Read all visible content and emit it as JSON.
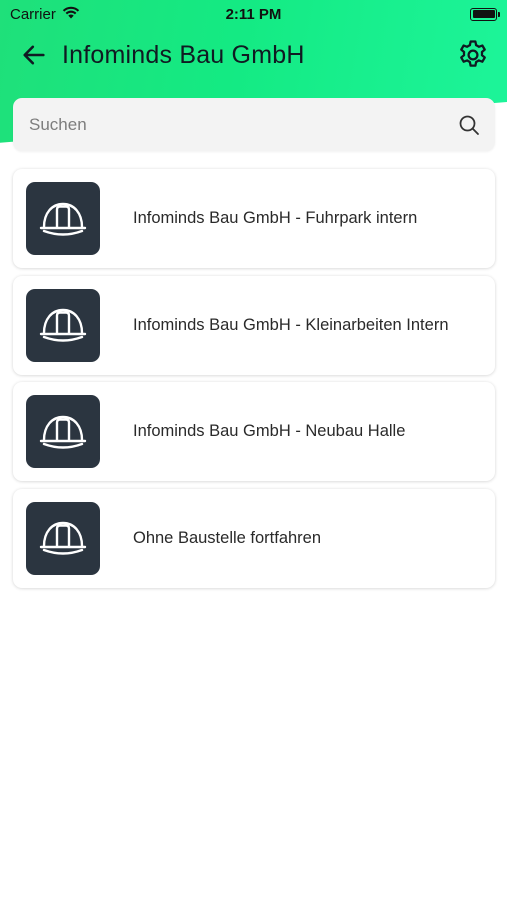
{
  "status_bar": {
    "carrier": "Carrier",
    "time": "2:11 PM"
  },
  "app_bar": {
    "title": "Infominds Bau GmbH",
    "back_icon": "arrow-left-icon",
    "settings_icon": "gear-icon"
  },
  "search": {
    "placeholder": "Suchen",
    "value": "",
    "icon": "search-icon"
  },
  "items": [
    {
      "label": "Infominds Bau GmbH - Fuhrpark intern",
      "icon": "hard-hat-icon"
    },
    {
      "label": "Infominds Bau GmbH - Kleinarbeiten Intern",
      "icon": "hard-hat-icon"
    },
    {
      "label": "Infominds Bau GmbH - Neubau Halle",
      "icon": "hard-hat-icon"
    },
    {
      "label": "Ohne Baustelle fortfahren",
      "icon": "hard-hat-icon"
    }
  ],
  "colors": {
    "accent": "#14ea83",
    "icon_tile": "#2b3540",
    "search_bg": "#f3f3f3"
  }
}
